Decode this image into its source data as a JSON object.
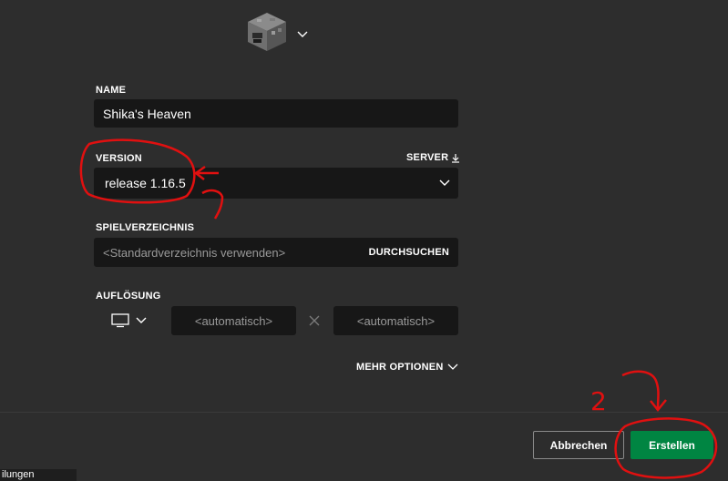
{
  "form": {
    "name_label": "NAME",
    "name_value": "Shika's Heaven",
    "version_label": "VERSION",
    "server_label": "SERVER",
    "version_value": "release 1.16.5",
    "directory_label": "SPIELVERZEICHNIS",
    "directory_placeholder": "<Standardverzeichnis verwenden>",
    "browse_label": "DURCHSUCHEN",
    "resolution_label": "AUFLÖSUNG",
    "width_placeholder": "<automatisch>",
    "height_placeholder": "<automatisch>",
    "more_options_label": "MEHR OPTIONEN"
  },
  "footer": {
    "cancel_label": "Abbrechen",
    "create_label": "Erstellen",
    "cut_off_text": "ilungen"
  },
  "annotations": {
    "marker_1": "",
    "marker_2": "2"
  },
  "colors": {
    "background": "#2d2d2d",
    "field": "#171717",
    "create_button": "#008542",
    "annotation_red": "#e01010"
  },
  "icons": {
    "profile_icon": "furnace-block-icon",
    "chevron": "chevron-down-icon",
    "server_download": "download-icon",
    "monitor": "monitor-icon",
    "times": "times-icon"
  }
}
